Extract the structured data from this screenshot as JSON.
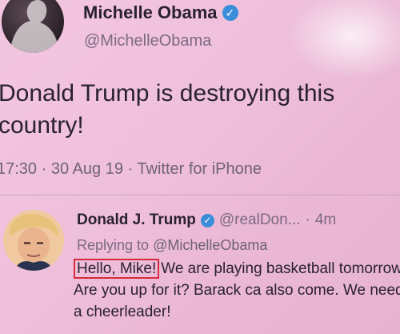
{
  "tweet": {
    "author_name": "Michelle Obama",
    "author_handle": "@MichelleObama",
    "text": "Donald Trump is destroying this country!",
    "time": "17:30",
    "date": "30 Aug 19",
    "source": "Twitter for iPhone",
    "separator": "·"
  },
  "reply": {
    "author_name": "Donald J. Trump",
    "author_handle": "@realDon...",
    "time": "4m",
    "replying_prefix": "Replying to",
    "replying_to": "@MichelleObama",
    "highlighted_text": "Hello, Mike!",
    "body_text": "We are playing basketball tomorrow. Are you up for it? Barack ca also come. We need a cheerleader!"
  },
  "colors": {
    "background": "#efc0dc",
    "verified": "#3a8dd8",
    "highlight_border": "#d62b3a"
  },
  "icons": {
    "verified_badge": "verified-check-icon"
  }
}
